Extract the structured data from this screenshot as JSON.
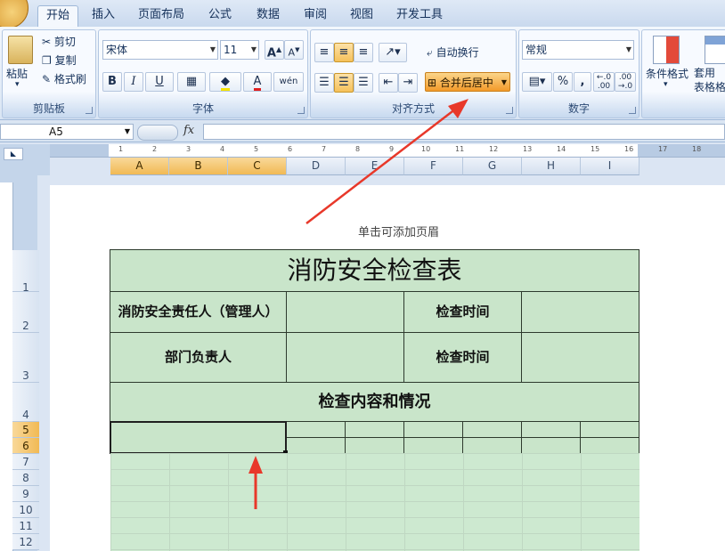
{
  "tabs": [
    "开始",
    "插入",
    "页面布局",
    "公式",
    "数据",
    "审阅",
    "视图",
    "开发工具"
  ],
  "clipboard": {
    "paste": "粘贴",
    "cut": "剪切",
    "copy": "复制",
    "format_painter": "格式刷",
    "label": "剪贴板"
  },
  "font": {
    "name": "宋体",
    "size": "11",
    "label": "字体",
    "bold": "B",
    "italic": "I",
    "underline": "U"
  },
  "alignment": {
    "wrap_text": "自动换行",
    "merge_center": "合并后居中",
    "label": "对齐方式"
  },
  "number": {
    "format": "常规",
    "percent": "%",
    "comma": ",",
    "label": "数字"
  },
  "styles": {
    "conditional": "条件格式",
    "table_format": "套用\n表格格"
  },
  "formula_bar": {
    "name_box": "A5",
    "fx": "fx"
  },
  "ruler_numbers": [
    "1",
    "2",
    "3",
    "4",
    "5",
    "6",
    "7",
    "8",
    "9",
    "10",
    "11",
    "12",
    "13",
    "14",
    "15",
    "16",
    "17",
    "18"
  ],
  "columns": [
    "A",
    "B",
    "C",
    "D",
    "E",
    "F",
    "G",
    "H",
    "I"
  ],
  "rows": [
    "1",
    "2",
    "3",
    "4",
    "5",
    "6",
    "7",
    "8",
    "9",
    "10",
    "11",
    "12"
  ],
  "header_hint": "单击可添加页眉",
  "sheet": {
    "title": "消防安全检查表",
    "r2_label": "消防安全责任人（管理人）",
    "r2_time": "检查时间",
    "r3_label": "部门负责人",
    "r3_time": "检查时间",
    "r4": "检查内容和情况"
  },
  "colors": {
    "accent": "#f0a030",
    "arrow": "#e8382a",
    "cell_fill": "#c9e5ca"
  }
}
